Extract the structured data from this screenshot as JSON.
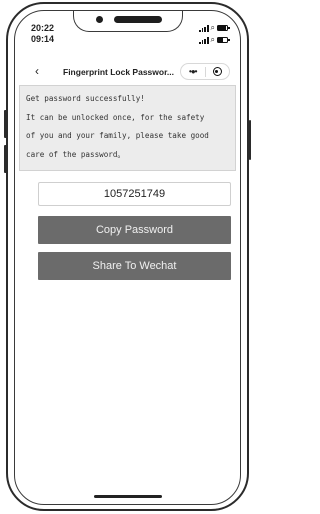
{
  "status_bar": {
    "time_1": "20:22",
    "time_2": "09:14",
    "battery_level": 0.9,
    "battery_level_2": 0.5
  },
  "navbar": {
    "back_icon": "chevron-left-icon",
    "title": "Fingerprint Lock Passwor...",
    "more_icon": "more-dots-icon",
    "close_icon": "target-circle-icon"
  },
  "message": {
    "line_1": "Get password successfully!",
    "line_2": "It can be unlocked once, for the safety",
    "line_3": "of you and your family, please take good",
    "line_4": "care of the password。"
  },
  "password": {
    "value": "1057251749"
  },
  "buttons": {
    "copy_label": "Copy Password",
    "share_label": "Share To Wechat"
  },
  "colors": {
    "button_bg": "#6b6b6b",
    "message_bg": "#ececec"
  }
}
